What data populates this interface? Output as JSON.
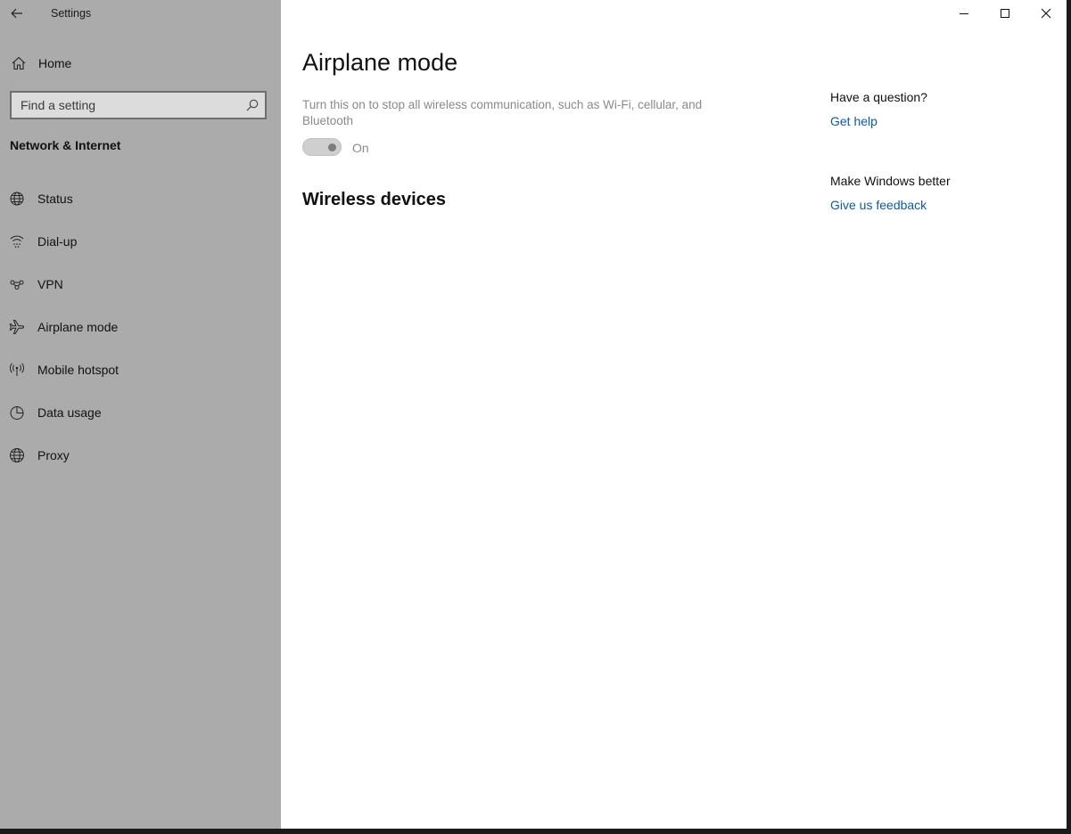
{
  "window": {
    "app_title": "Settings"
  },
  "sidebar": {
    "home_label": "Home",
    "search_placeholder": "Find a setting",
    "section_title": "Network & Internet",
    "items": [
      {
        "label": "Status",
        "icon": "globe-status-icon"
      },
      {
        "label": "Dial-up",
        "icon": "dial-up-icon"
      },
      {
        "label": "VPN",
        "icon": "vpn-icon"
      },
      {
        "label": "Airplane mode",
        "icon": "airplane-icon"
      },
      {
        "label": "Mobile hotspot",
        "icon": "hotspot-icon"
      },
      {
        "label": "Data usage",
        "icon": "pie-chart-icon"
      },
      {
        "label": "Proxy",
        "icon": "globe-icon"
      }
    ]
  },
  "main": {
    "title": "Airplane mode",
    "description": "Turn this on to stop all wireless communication, such as Wi-Fi, cellular, and Bluetooth",
    "toggle_state": "On",
    "wireless_title": "Wireless devices"
  },
  "aside": {
    "question_title": "Have a question?",
    "get_help": "Get help",
    "feedback_title": "Make Windows better",
    "feedback_link": "Give us feedback"
  },
  "colors": {
    "sidebar_bg": "#ababab",
    "link": "#0a5aa8",
    "disabled_text": "#8a8a8a"
  }
}
